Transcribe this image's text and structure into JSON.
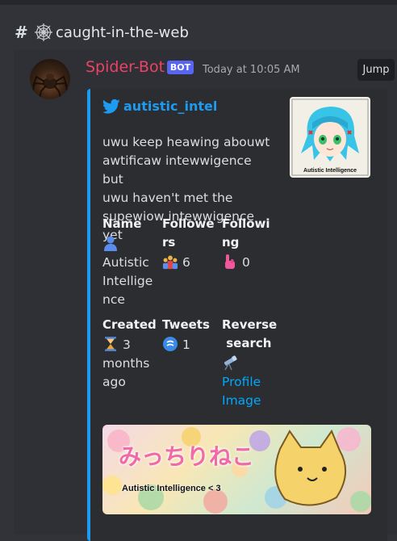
{
  "channel": {
    "hash": "#",
    "name": "caught-in-the-web"
  },
  "message": {
    "author": "Spider-Bot",
    "badge": "BOT",
    "timestamp": "Today at 10:05 AM",
    "jump_label": "Jump"
  },
  "embed": {
    "accent_color": "#1d9bf0",
    "author": "autistic_intel",
    "description": [
      "uwu keep heawing abouwt",
      "awtificaw intewwigence but",
      "uwu haven't met the",
      "supewiow intewwigence yet"
    ],
    "thumbnail_caption": "Autistic Intelligence",
    "fields": {
      "name": {
        "label": "Name",
        "icon": "person-emoji",
        "value_lines": [
          "Autistic",
          "Intellige",
          "nce"
        ]
      },
      "followers": {
        "label_lines": [
          "Followe",
          "rs"
        ],
        "icon": "people-emoji",
        "value": "6"
      },
      "following": {
        "label_lines": [
          "Followi",
          "ng"
        ],
        "icon": "pointing-hand-emoji",
        "value": "0"
      },
      "created": {
        "label": "Created",
        "icon": "hourglass-emoji",
        "value_lines": [
          "3",
          "months",
          "ago"
        ]
      },
      "tweets": {
        "label": "Tweets",
        "icon": "speech-bubble-emoji",
        "value": "1"
      },
      "reverse_search": {
        "label_lines": [
          "Reverse",
          " search"
        ],
        "icon": "telescope-emoji",
        "link_lines": [
          "Profile",
          "Image"
        ]
      }
    },
    "banner": {
      "title": "みっちりねこ",
      "caption": "Autistic Intelligence < 3"
    }
  }
}
